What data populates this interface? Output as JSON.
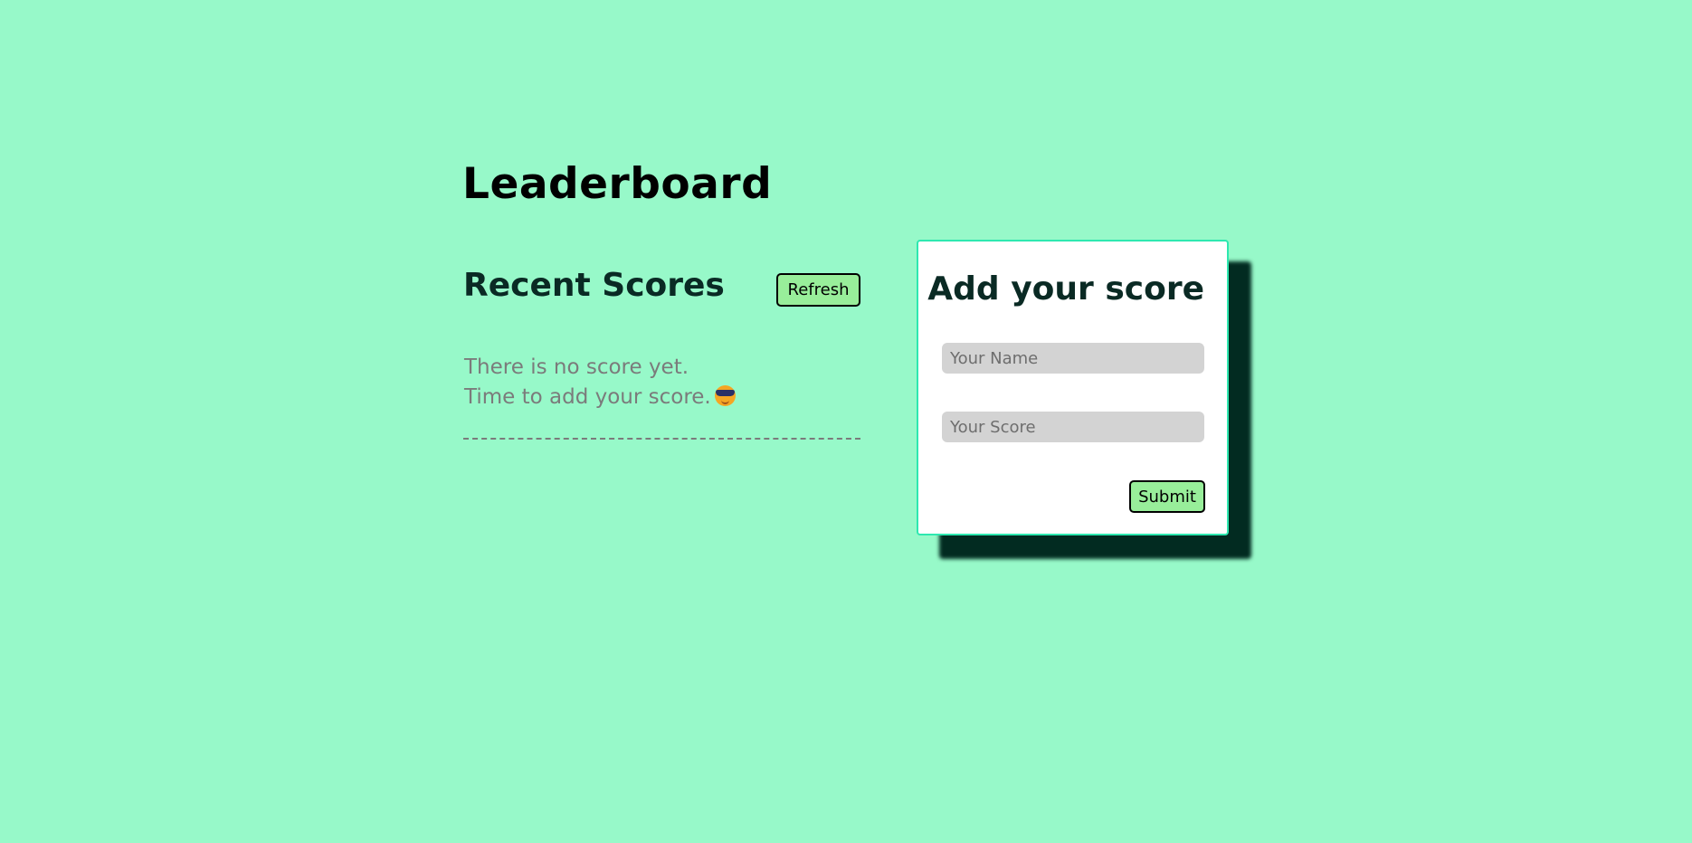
{
  "page": {
    "title": "Leaderboard"
  },
  "recent": {
    "heading": "Recent Scores",
    "refresh_label": "Refresh",
    "empty_line1": "There is no score yet.",
    "empty_line2": "Time to add your score.",
    "emoji_icon": "smiling-face-with-sunglasses-icon"
  },
  "form": {
    "heading": "Add your score",
    "name_placeholder": "Your Name",
    "name_value": "",
    "score_placeholder": "Your Score",
    "score_value": "",
    "submit_label": "Submit"
  },
  "colors": {
    "background": "#97f9c9",
    "button": "#98ee9a",
    "card_border": "#2ee8b0",
    "card_shadow": "#022b21",
    "heading_text": "#0a2a24",
    "muted_text": "#7b7b7b",
    "input_bg": "#d3d3d3"
  }
}
